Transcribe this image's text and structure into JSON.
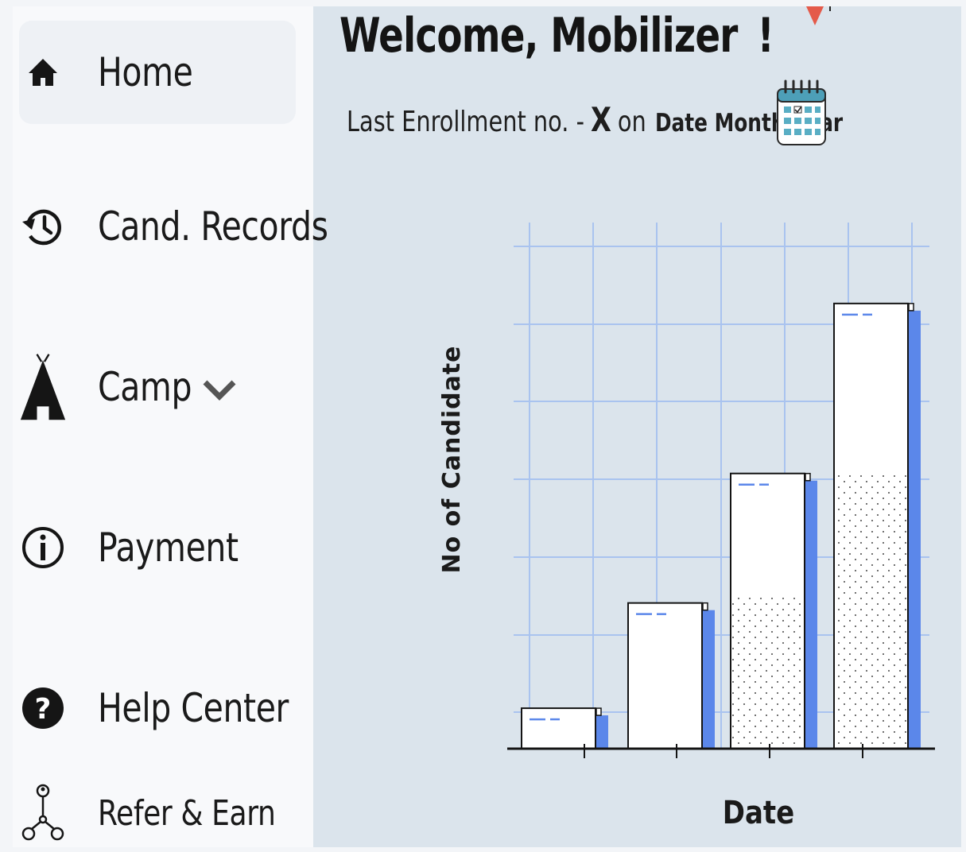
{
  "sidebar": {
    "items": [
      {
        "label": "Home",
        "icon": "home-icon",
        "active": true
      },
      {
        "label": "Cand. Records",
        "icon": "history-icon"
      },
      {
        "label": "Camp",
        "icon": "tent-icon",
        "dropdown_icon": "chevron-down-icon"
      },
      {
        "label": "Payment",
        "icon": "info-icon"
      },
      {
        "label": "Help Center",
        "icon": "question-icon"
      },
      {
        "label": "Refer & Earn",
        "icon": "referral-network-icon"
      }
    ]
  },
  "header": {
    "welcome": "Welcome, Mobilizer",
    "exclaim": "!",
    "enrollment_prefix": "Last Enrollment no. -",
    "enrollment_value": "X",
    "enrollment_on": "on",
    "enrollment_date": "Date Month",
    "enrollment_year": "Year",
    "calendar_icon": "calendar-icon"
  },
  "colors": {
    "accent": "#5b87ea",
    "grid": "#a9c3ef",
    "panel": "#dbe4ec",
    "sidebar": "#f8f9fb"
  },
  "chart_data": {
    "type": "bar",
    "xlabel": "Date",
    "ylabel": "No of Candidate",
    "grid": true,
    "categories": [
      "",
      "",
      "",
      ""
    ],
    "values": [
      0.5,
      1.8,
      3.4,
      5.5
    ],
    "ylim": [
      0,
      6.5
    ]
  }
}
